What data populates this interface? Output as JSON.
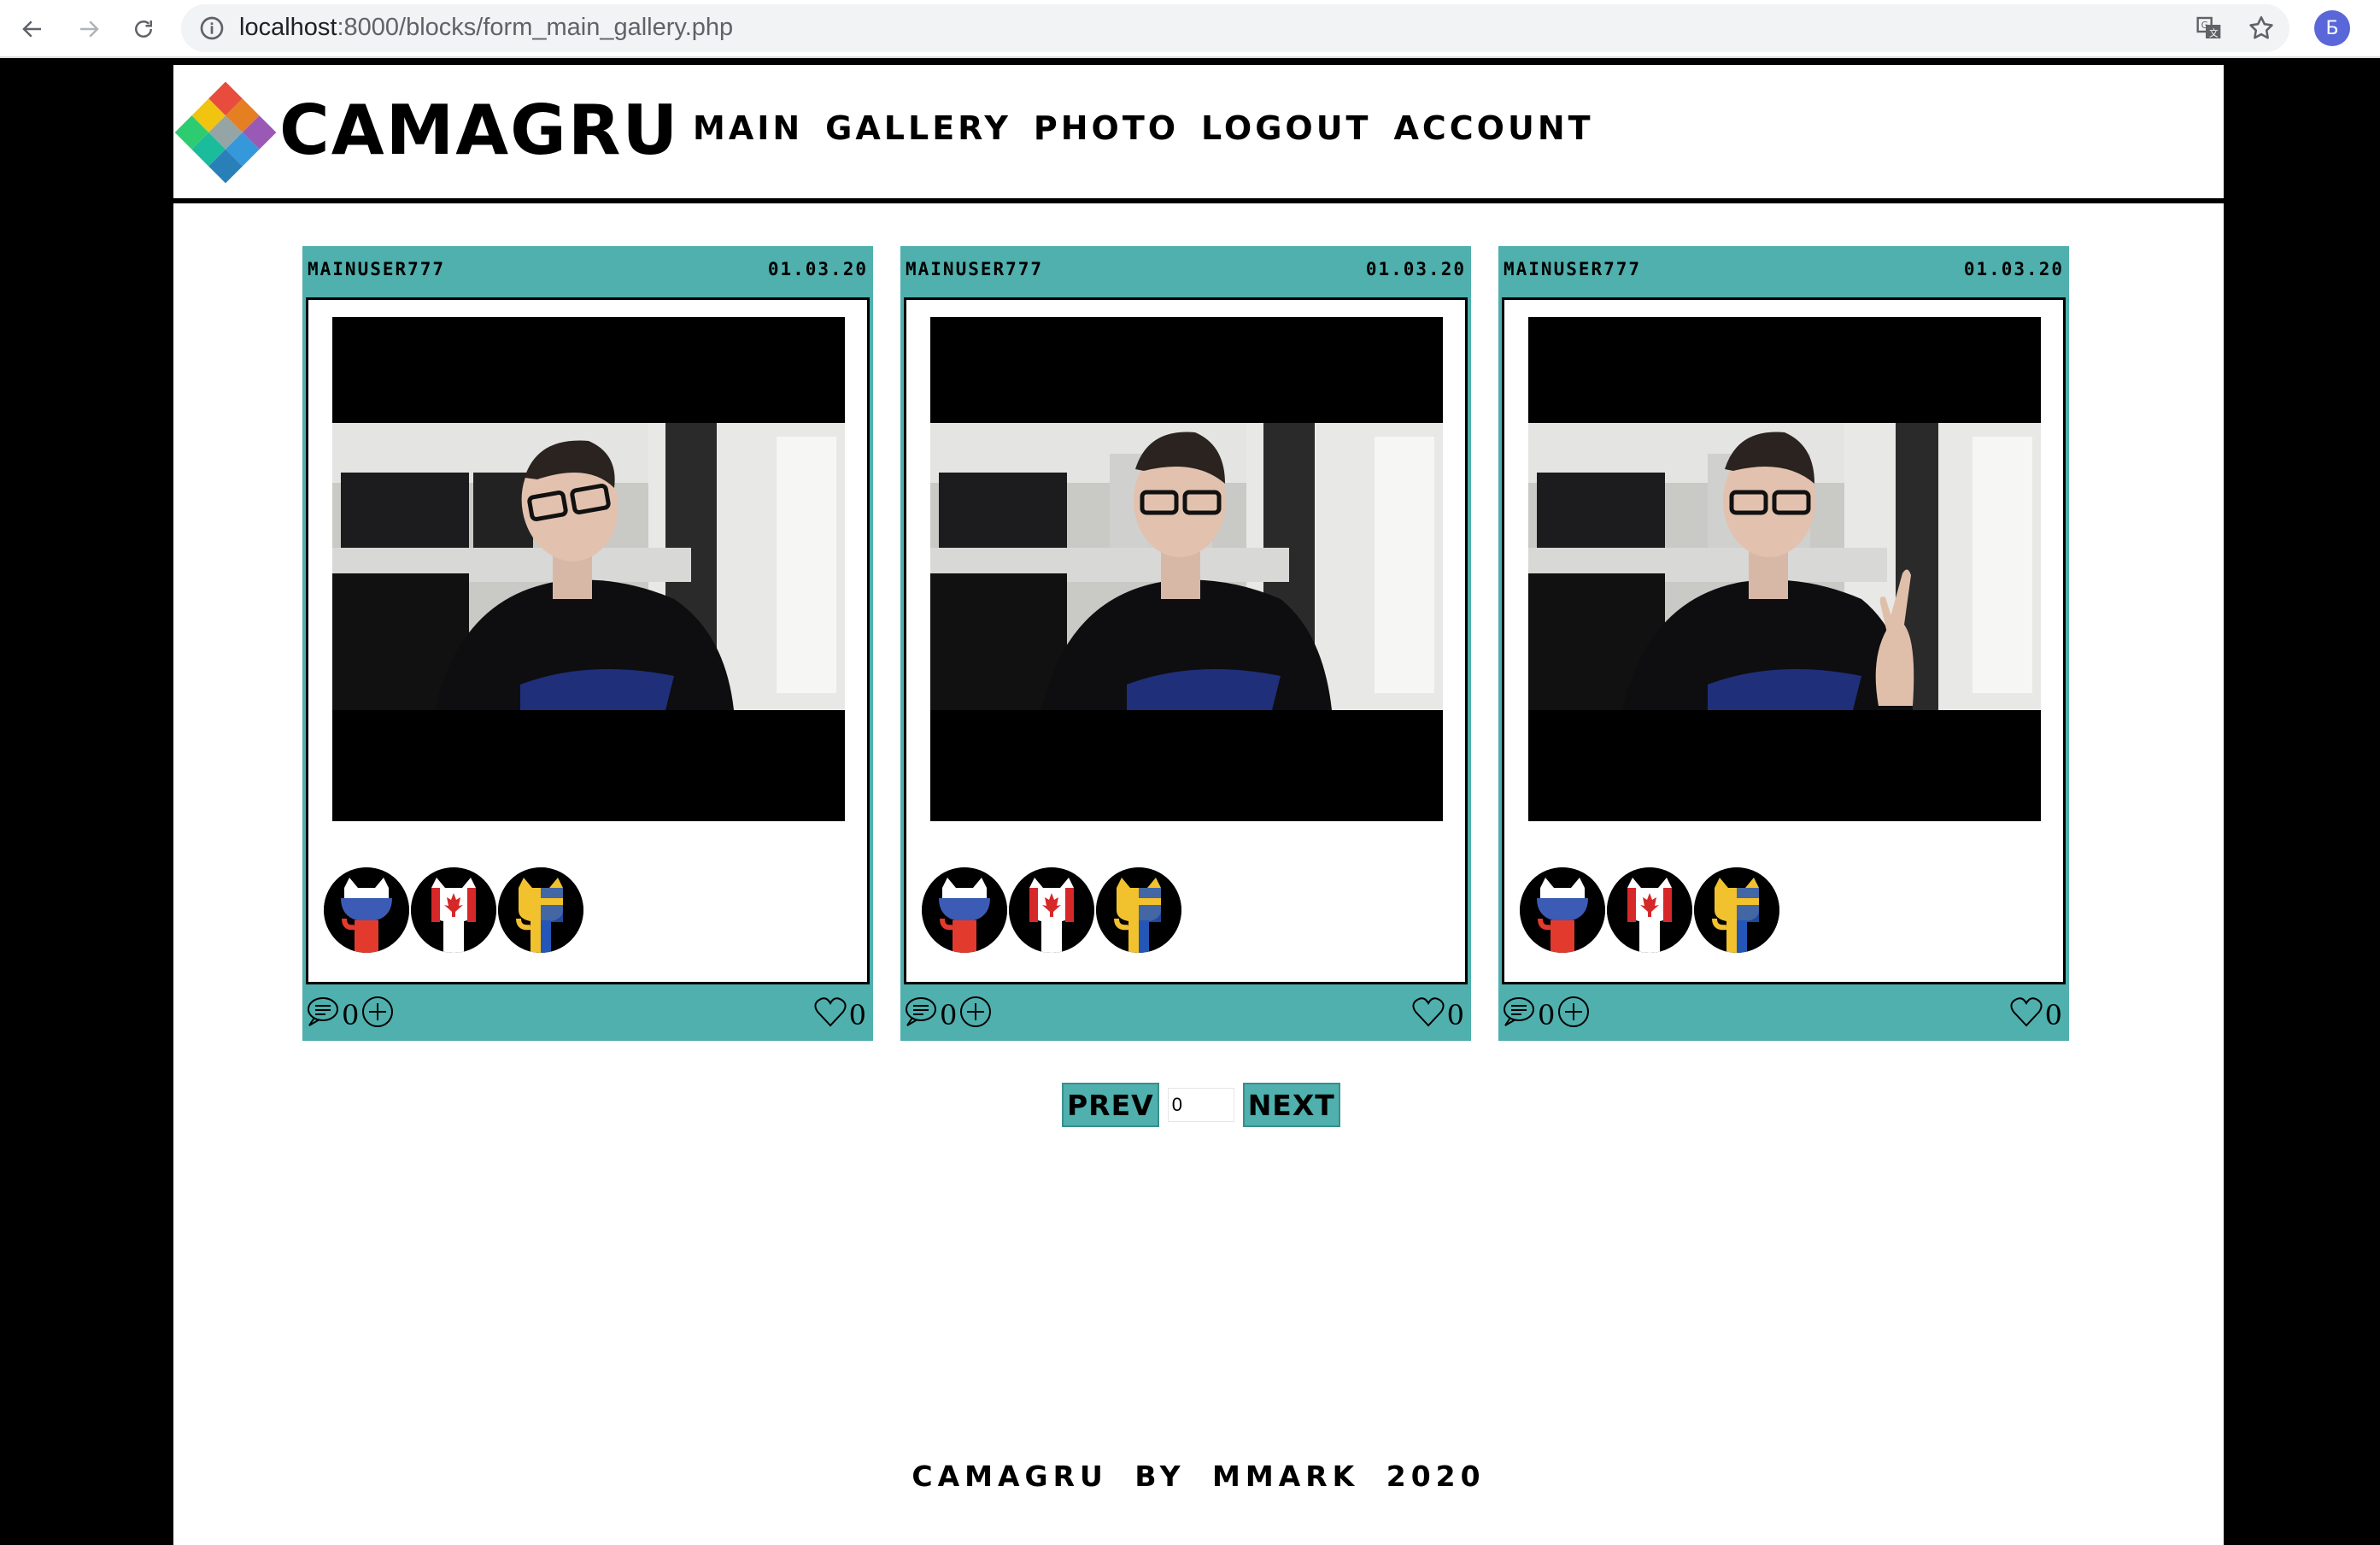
{
  "browser": {
    "url_host": "localhost",
    "url_rest": ":8000/blocks/form_main_gallery.php",
    "profile_initial": "Б"
  },
  "site": {
    "logo_text": "CAMAGRU",
    "nav": [
      "MAIN",
      "GALLERY",
      "PHOTO",
      "LOGOUT",
      "ACCOUNT"
    ]
  },
  "colors": {
    "accent": "#4fb0ae",
    "text": "#000000",
    "background": "#ffffff"
  },
  "posts": [
    {
      "username": "MAINUSER777",
      "date": "01.03.20",
      "comments": "0",
      "likes": "0",
      "pose": "tilted-head",
      "stickers": [
        "octocat-russia-sticker",
        "octocat-canada-sticker",
        "octocat-ukraine-sticker"
      ]
    },
    {
      "username": "MAINUSER777",
      "date": "01.03.20",
      "comments": "0",
      "likes": "0",
      "pose": "straight",
      "stickers": [
        "octocat-russia-sticker",
        "octocat-canada-sticker",
        "octocat-ukraine-sticker"
      ]
    },
    {
      "username": "MAINUSER777",
      "date": "01.03.20",
      "comments": "0",
      "likes": "0",
      "pose": "rock-hand",
      "stickers": [
        "octocat-russia-sticker",
        "octocat-canada-sticker",
        "octocat-ukraine-sticker"
      ]
    }
  ],
  "pager": {
    "prev_label": "PREV",
    "next_label": "NEXT",
    "page_value": "0"
  },
  "footer": {
    "text": "CAMAGRU BY MMARK 2020"
  }
}
